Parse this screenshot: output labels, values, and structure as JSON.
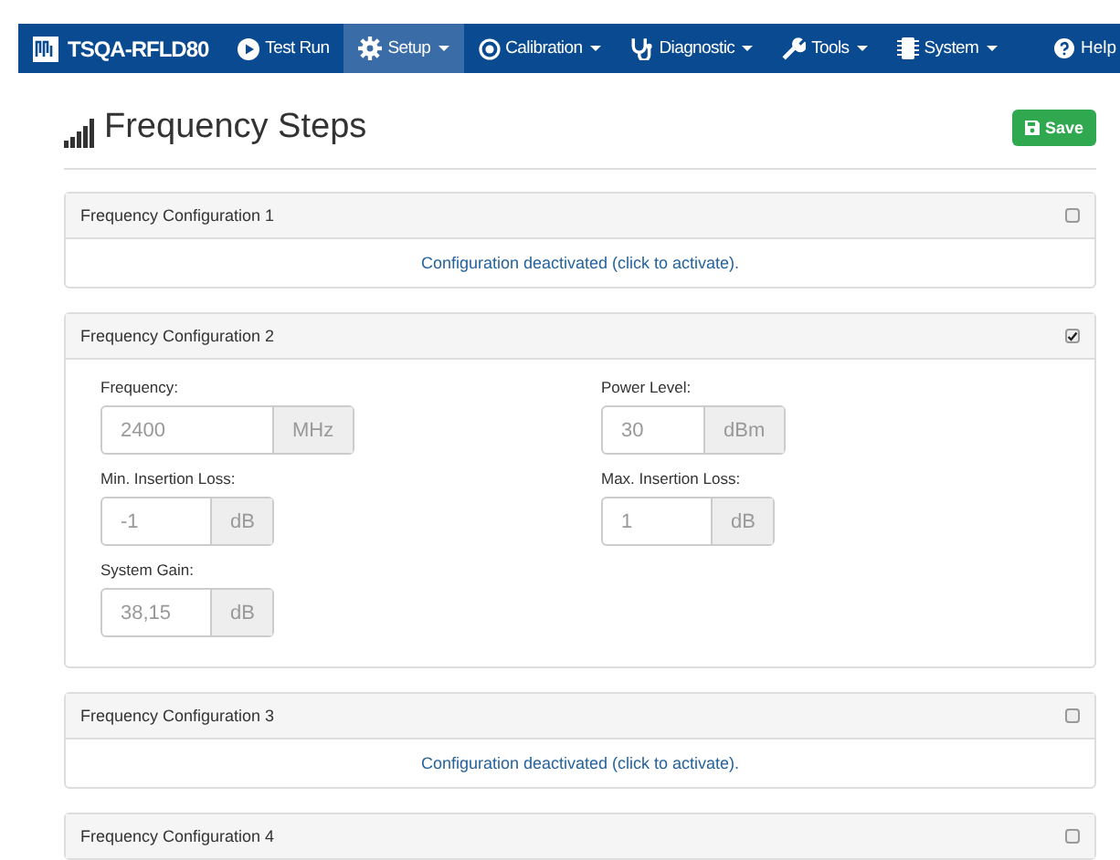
{
  "navbar": {
    "brand": "TSQA-RFLD80",
    "items": [
      {
        "label": "Test Run",
        "dropdown": false,
        "selected": false
      },
      {
        "label": "Setup",
        "dropdown": true,
        "selected": true
      },
      {
        "label": "Calibration",
        "dropdown": true,
        "selected": false
      },
      {
        "label": "Diagnostic",
        "dropdown": true,
        "selected": false
      },
      {
        "label": "Tools",
        "dropdown": true,
        "selected": false
      },
      {
        "label": "System",
        "dropdown": true,
        "selected": false
      }
    ],
    "help": "Help"
  },
  "page": {
    "title": "Frequency Steps",
    "save": "Save"
  },
  "panels": [
    {
      "title": "Frequency Configuration 1",
      "checked": false,
      "message": "Configuration deactivated (click to activate)."
    },
    {
      "title": "Frequency Configuration 2",
      "checked": true,
      "fields": [
        {
          "label": "Frequency:",
          "value": "2400",
          "unit": "MHz"
        },
        {
          "label": "Power Level:",
          "value": "30",
          "unit": "dBm"
        },
        {
          "label": "Min. Insertion Loss:",
          "value": "-1",
          "unit": "dB"
        },
        {
          "label": "Max. Insertion Loss:",
          "value": "1",
          "unit": "dB"
        },
        {
          "label": "System Gain:",
          "value": "38,15",
          "unit": "dB"
        }
      ]
    },
    {
      "title": "Frequency Configuration 3",
      "checked": false,
      "message": "Configuration deactivated (click to activate)."
    },
    {
      "title": "Frequency Configuration 4",
      "checked": false
    }
  ]
}
